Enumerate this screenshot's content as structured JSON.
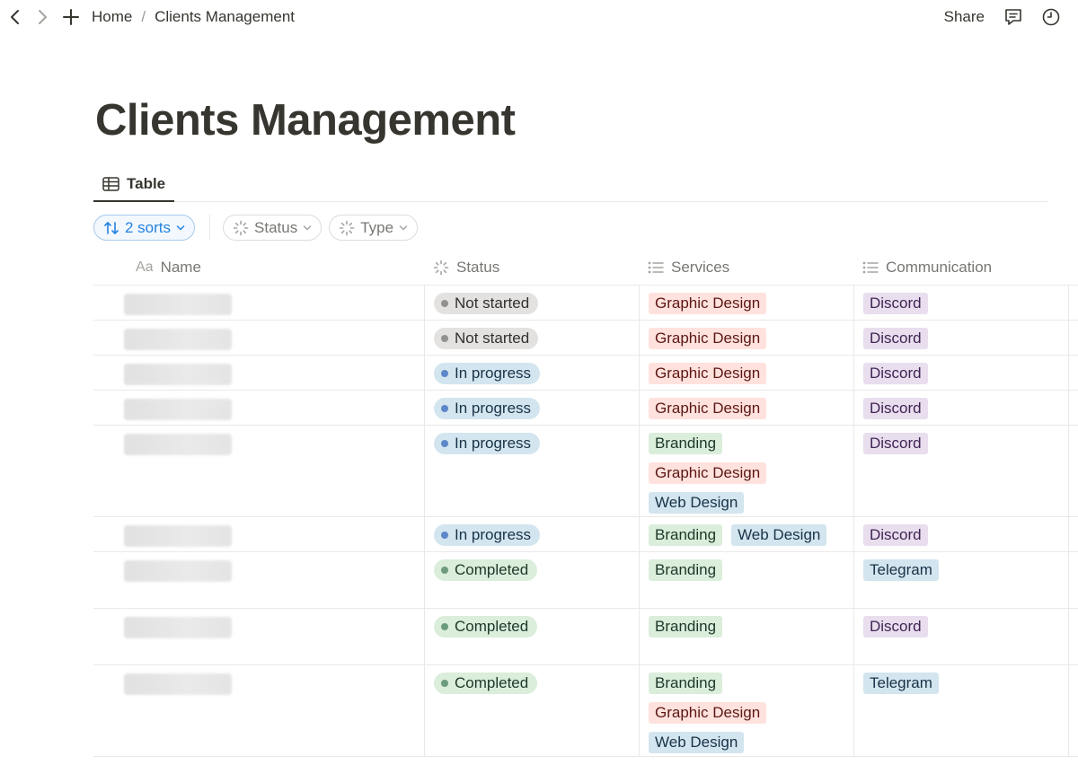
{
  "breadcrumb": {
    "home": "Home",
    "separator": "/",
    "current": "Clients Management"
  },
  "topbar": {
    "share_label": "Share"
  },
  "page": {
    "title": "Clients Management"
  },
  "views": [
    {
      "label": "Table",
      "icon": "table-icon"
    }
  ],
  "filters": {
    "sorts_label": "2 sorts",
    "status_label": "Status",
    "type_label": "Type"
  },
  "columns": [
    {
      "label": "Name",
      "icon": "text-property-icon"
    },
    {
      "label": "Status",
      "icon": "status-property-icon"
    },
    {
      "label": "Services",
      "icon": "multiselect-property-icon"
    },
    {
      "label": "Communication",
      "icon": "multiselect-property-icon"
    }
  ],
  "colors": {
    "not_started": {
      "bg": "#e3e2e0",
      "dot": "#91918e",
      "text": "#32302c"
    },
    "in_progress": {
      "bg": "#d3e5ef",
      "dot": "#5e87c9",
      "text": "#183347"
    },
    "completed": {
      "bg": "#dbeddb",
      "dot": "#6c9b7d",
      "text": "#1c3829"
    },
    "tag_red": {
      "bg": "#ffe2dd",
      "text": "#5d1715"
    },
    "tag_green": {
      "bg": "#dbeddb",
      "text": "#1c3829"
    },
    "tag_blue": {
      "bg": "#d3e5ef",
      "text": "#183347"
    },
    "tag_purple": {
      "bg": "#e8deee",
      "text": "#412454"
    }
  },
  "rows": [
    {
      "status": "Not started",
      "status_key": "not_started",
      "services": [
        {
          "label": "Graphic Design",
          "color": "tag_red"
        }
      ],
      "communication": [
        {
          "label": "Discord",
          "color": "tag_purple"
        }
      ]
    },
    {
      "status": "Not started",
      "status_key": "not_started",
      "services": [
        {
          "label": "Graphic Design",
          "color": "tag_red"
        }
      ],
      "communication": [
        {
          "label": "Discord",
          "color": "tag_purple"
        }
      ]
    },
    {
      "status": "In progress",
      "status_key": "in_progress",
      "services": [
        {
          "label": "Graphic Design",
          "color": "tag_red"
        }
      ],
      "communication": [
        {
          "label": "Discord",
          "color": "tag_purple"
        }
      ]
    },
    {
      "status": "In progress",
      "status_key": "in_progress",
      "services": [
        {
          "label": "Graphic Design",
          "color": "tag_red"
        }
      ],
      "communication": [
        {
          "label": "Discord",
          "color": "tag_purple"
        }
      ]
    },
    {
      "status": "In progress",
      "status_key": "in_progress",
      "services": [
        {
          "label": "Branding",
          "color": "tag_green"
        },
        {
          "label": "Graphic Design",
          "color": "tag_red"
        },
        {
          "label": "Web Design",
          "color": "tag_blue"
        }
      ],
      "communication": [
        {
          "label": "Discord",
          "color": "tag_purple"
        }
      ]
    },
    {
      "status": "In progress",
      "status_key": "in_progress",
      "services": [
        {
          "label": "Branding",
          "color": "tag_green"
        },
        {
          "label": "Web Design",
          "color": "tag_blue"
        }
      ],
      "communication": [
        {
          "label": "Discord",
          "color": "tag_purple"
        }
      ]
    },
    {
      "status": "Completed",
      "status_key": "completed",
      "services": [
        {
          "label": "Branding",
          "color": "tag_green"
        }
      ],
      "communication": [
        {
          "label": "Telegram",
          "color": "tag_blue"
        }
      ]
    },
    {
      "status": "Completed",
      "status_key": "completed",
      "services": [
        {
          "label": "Branding",
          "color": "tag_green"
        }
      ],
      "communication": [
        {
          "label": "Discord",
          "color": "tag_purple"
        }
      ]
    },
    {
      "status": "Completed",
      "status_key": "completed",
      "services": [
        {
          "label": "Branding",
          "color": "tag_green"
        },
        {
          "label": "Graphic Design",
          "color": "tag_red"
        },
        {
          "label": "Web Design",
          "color": "tag_blue"
        }
      ],
      "communication": [
        {
          "label": "Telegram",
          "color": "tag_blue"
        }
      ]
    }
  ]
}
